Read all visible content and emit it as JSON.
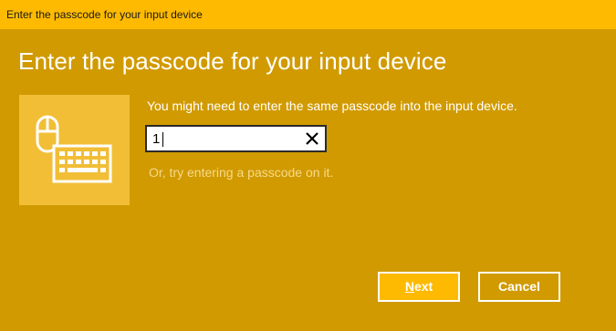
{
  "window": {
    "title": "Enter the passcode for your input device",
    "titlebar_color": "#FDBA00",
    "background_color": "#D19A00"
  },
  "main": {
    "heading": "Enter the passcode for your input device",
    "device_icon": "mouse-and-keyboard-icon",
    "instruction": "You might need to enter the same passcode into the input device.",
    "passcode": {
      "value": "1",
      "clear_icon": "close-icon"
    },
    "hint": "Or, try entering a passcode on it."
  },
  "buttons": {
    "next": {
      "mnemonic": "N",
      "rest": "ext"
    },
    "cancel": "Cancel"
  }
}
